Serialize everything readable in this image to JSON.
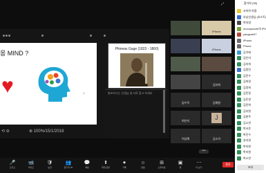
{
  "slide": {
    "title": "응 MIND ?",
    "nav_next": "›"
  },
  "shared_controls": {
    "left_label": "⟲ ⊖",
    "page_label": "⊕ 100%/15/1/2018"
  },
  "side": {
    "gage_title": "Phineas Gage (1823 - 1860)",
    "note": "발표하시는 선생님 옆 자료 참고 하세요"
  },
  "gallery": {
    "tiles": [
      {
        "name": ""
      },
      {
        "name": "iPhone"
      },
      {
        "name": ""
      },
      {
        "name": "iPhone"
      },
      {
        "name": ""
      },
      {
        "name": ""
      },
      {
        "name": ""
      },
      {
        "name": "김지희"
      },
      {
        "name": "임수옥"
      },
      {
        "name": "김해원"
      },
      {
        "name": "허은지"
      },
      {
        "name": "J"
      },
      {
        "name": "이상해"
      },
      {
        "name": "김소이"
      }
    ],
    "more": "•••"
  },
  "participants": {
    "title": "참가자 (35)",
    "items": [
      {
        "name": "코미쉬 마을",
        "color": "#e6c83a"
      },
      {
        "name": "부남선생님 (호스트)",
        "color": "#3b6fd1"
      },
      {
        "name": "박지영",
        "color": "#4a4a4a"
      },
      {
        "name": "oncuxpuzzle의 iPhone",
        "color": "#7aa33a"
      },
      {
        "name": "yangsub97",
        "color": "#b24a3a"
      },
      {
        "name": "iPhone",
        "color": "#6b6b6b"
      },
      {
        "name": "Phone",
        "color": "#6b6b6b"
      },
      {
        "name": "김기태",
        "color": "#3b9bd1"
      },
      {
        "name": "김은자",
        "color": "#2f8f5a"
      },
      {
        "name": "김지희",
        "color": "#2f8f5a"
      },
      {
        "name": "김정민",
        "color": "#3b6fd1"
      },
      {
        "name": "김민수",
        "color": "#2f8f5a"
      },
      {
        "name": "김희영",
        "color": "#2f8f5a"
      },
      {
        "name": "김정희",
        "color": "#2f8f5a"
      },
      {
        "name": "김민정",
        "color": "#2f8f5a"
      },
      {
        "name": "김은영",
        "color": "#2f8f5a"
      },
      {
        "name": "김민희",
        "color": "#2f8f5a"
      },
      {
        "name": "김지현",
        "color": "#2f8f5a"
      },
      {
        "name": "김현주",
        "color": "#2f8f5a"
      },
      {
        "name": "김소연",
        "color": "#2f8f5a"
      },
      {
        "name": "박서윤",
        "color": "#2f8f5a"
      },
      {
        "name": "박진수",
        "color": "#2f8f5a"
      },
      {
        "name": "송지영",
        "color": "#2f8f5a"
      },
      {
        "name": "박지현",
        "color": "#2f8f5a"
      },
      {
        "name": "박지원",
        "color": "#2f8f5a"
      },
      {
        "name": "박소연",
        "color": "#2f8f5a"
      }
    ],
    "invite": "초대"
  },
  "toolbar": [
    {
      "icon": "🎤",
      "label": "오디오"
    },
    {
      "icon": "📹",
      "label": "비디오"
    },
    {
      "icon": "🛡",
      "label": "보안"
    },
    {
      "icon": "👥",
      "label": "참가자 35"
    },
    {
      "icon": "💬",
      "label": "채팅"
    },
    {
      "icon": "⬆",
      "label": "화면 공유"
    },
    {
      "icon": "⏺",
      "label": "기록"
    },
    {
      "icon": "☺",
      "label": "반응"
    },
    {
      "icon": "⊞",
      "label": "소회의실"
    },
    {
      "icon": "▣",
      "label": "앱"
    },
    {
      "icon": "⋯",
      "label": "더 보기"
    }
  ],
  "end_label": "종료",
  "top_right": "⤢"
}
